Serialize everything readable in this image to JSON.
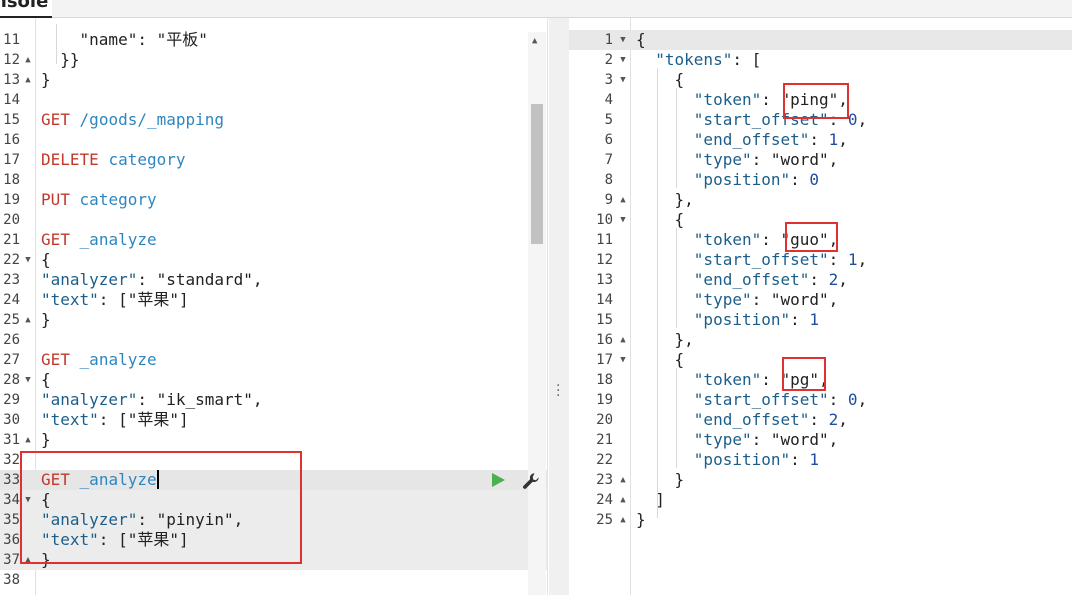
{
  "topbar": {
    "tab_label": "nsole"
  },
  "left_editor": {
    "lines": [
      {
        "n": "11",
        "fold": "",
        "tokens": [
          [
            "p",
            "    \"name\": \"平板\""
          ]
        ]
      },
      {
        "n": "12",
        "fold": "▲",
        "tokens": [
          [
            "p",
            "  }}"
          ]
        ]
      },
      {
        "n": "13",
        "fold": "▲",
        "tokens": [
          [
            "p",
            "}"
          ]
        ]
      },
      {
        "n": "14",
        "fold": "",
        "tokens": []
      },
      {
        "n": "15",
        "fold": "",
        "tokens": [
          [
            "m",
            "GET"
          ],
          [
            "p",
            " "
          ],
          [
            "u",
            "/goods/_mapping"
          ]
        ]
      },
      {
        "n": "16",
        "fold": "",
        "tokens": []
      },
      {
        "n": "17",
        "fold": "",
        "tokens": [
          [
            "m",
            "DELETE"
          ],
          [
            "p",
            " "
          ],
          [
            "u",
            "category"
          ]
        ]
      },
      {
        "n": "18",
        "fold": "",
        "tokens": []
      },
      {
        "n": "19",
        "fold": "",
        "tokens": [
          [
            "m",
            "PUT"
          ],
          [
            "p",
            " "
          ],
          [
            "u",
            "category"
          ]
        ]
      },
      {
        "n": "20",
        "fold": "",
        "tokens": []
      },
      {
        "n": "21",
        "fold": "",
        "tokens": [
          [
            "m",
            "GET"
          ],
          [
            "p",
            " "
          ],
          [
            "u",
            "_analyze"
          ]
        ]
      },
      {
        "n": "22",
        "fold": "▼",
        "tokens": [
          [
            "p",
            "{"
          ]
        ]
      },
      {
        "n": "23",
        "fold": "",
        "tokens": [
          [
            "k",
            "\"analyzer\""
          ],
          [
            "p",
            ": "
          ],
          [
            "s",
            "\"standard\""
          ],
          [
            "p",
            ","
          ]
        ]
      },
      {
        "n": "24",
        "fold": "",
        "tokens": [
          [
            "k",
            "\"text\""
          ],
          [
            "p",
            ": ["
          ],
          [
            "s",
            "\"苹果\""
          ],
          [
            "p",
            "]"
          ]
        ]
      },
      {
        "n": "25",
        "fold": "▲",
        "tokens": [
          [
            "p",
            "}"
          ]
        ]
      },
      {
        "n": "26",
        "fold": "",
        "tokens": []
      },
      {
        "n": "27",
        "fold": "",
        "tokens": [
          [
            "m",
            "GET"
          ],
          [
            "p",
            " "
          ],
          [
            "u",
            "_analyze"
          ]
        ]
      },
      {
        "n": "28",
        "fold": "▼",
        "tokens": [
          [
            "p",
            "{"
          ]
        ]
      },
      {
        "n": "29",
        "fold": "",
        "tokens": [
          [
            "k",
            "\"analyzer\""
          ],
          [
            "p",
            ": "
          ],
          [
            "s",
            "\"ik_smart\""
          ],
          [
            "p",
            ","
          ]
        ]
      },
      {
        "n": "30",
        "fold": "",
        "tokens": [
          [
            "k",
            "\"text\""
          ],
          [
            "p",
            ": ["
          ],
          [
            "s",
            "\"苹果\""
          ],
          [
            "p",
            "]"
          ]
        ]
      },
      {
        "n": "31",
        "fold": "▲",
        "tokens": [
          [
            "p",
            "}"
          ]
        ]
      },
      {
        "n": "32",
        "fold": "",
        "tokens": []
      },
      {
        "n": "33",
        "fold": "",
        "tokens": [
          [
            "m",
            "GET"
          ],
          [
            "p",
            " "
          ],
          [
            "u",
            "_analyze"
          ]
        ]
      },
      {
        "n": "34",
        "fold": "▼",
        "tokens": [
          [
            "p",
            "{"
          ]
        ]
      },
      {
        "n": "35",
        "fold": "",
        "tokens": [
          [
            "k",
            "\"analyzer\""
          ],
          [
            "p",
            ": "
          ],
          [
            "s",
            "\"pinyin\""
          ],
          [
            "p",
            ","
          ]
        ]
      },
      {
        "n": "36",
        "fold": "",
        "tokens": [
          [
            "k",
            "\"text\""
          ],
          [
            "p",
            ": ["
          ],
          [
            "s",
            "\"苹果\""
          ],
          [
            "p",
            "]"
          ]
        ]
      },
      {
        "n": "37",
        "fold": "▲",
        "tokens": [
          [
            "p",
            "}"
          ]
        ]
      },
      {
        "n": "38",
        "fold": "",
        "tokens": []
      }
    ]
  },
  "right_editor": {
    "lines": [
      {
        "n": "1",
        "fold": "▼",
        "tokens": [
          [
            "p",
            "{"
          ]
        ]
      },
      {
        "n": "2",
        "fold": "▼",
        "tokens": [
          [
            "p",
            "  "
          ],
          [
            "k",
            "\"tokens\""
          ],
          [
            "p",
            ": ["
          ]
        ]
      },
      {
        "n": "3",
        "fold": "▼",
        "tokens": [
          [
            "p",
            "    {"
          ]
        ]
      },
      {
        "n": "4",
        "fold": "",
        "tokens": [
          [
            "p",
            "      "
          ],
          [
            "k",
            "\"token\""
          ],
          [
            "p",
            ": "
          ],
          [
            "s",
            "\"ping\""
          ],
          [
            "p",
            ","
          ]
        ]
      },
      {
        "n": "5",
        "fold": "",
        "tokens": [
          [
            "p",
            "      "
          ],
          [
            "k",
            "\"start_offset\""
          ],
          [
            "p",
            ": "
          ],
          [
            "n",
            "0"
          ],
          [
            "p",
            ","
          ]
        ]
      },
      {
        "n": "6",
        "fold": "",
        "tokens": [
          [
            "p",
            "      "
          ],
          [
            "k",
            "\"end_offset\""
          ],
          [
            "p",
            ": "
          ],
          [
            "n",
            "1"
          ],
          [
            "p",
            ","
          ]
        ]
      },
      {
        "n": "7",
        "fold": "",
        "tokens": [
          [
            "p",
            "      "
          ],
          [
            "k",
            "\"type\""
          ],
          [
            "p",
            ": "
          ],
          [
            "s",
            "\"word\""
          ],
          [
            "p",
            ","
          ]
        ]
      },
      {
        "n": "8",
        "fold": "",
        "tokens": [
          [
            "p",
            "      "
          ],
          [
            "k",
            "\"position\""
          ],
          [
            "p",
            ": "
          ],
          [
            "n",
            "0"
          ]
        ]
      },
      {
        "n": "9",
        "fold": "▲",
        "tokens": [
          [
            "p",
            "    },"
          ]
        ]
      },
      {
        "n": "10",
        "fold": "▼",
        "tokens": [
          [
            "p",
            "    {"
          ]
        ]
      },
      {
        "n": "11",
        "fold": "",
        "tokens": [
          [
            "p",
            "      "
          ],
          [
            "k",
            "\"token\""
          ],
          [
            "p",
            ": "
          ],
          [
            "s",
            "\"guo\""
          ],
          [
            "p",
            ","
          ]
        ]
      },
      {
        "n": "12",
        "fold": "",
        "tokens": [
          [
            "p",
            "      "
          ],
          [
            "k",
            "\"start_offset\""
          ],
          [
            "p",
            ": "
          ],
          [
            "n",
            "1"
          ],
          [
            "p",
            ","
          ]
        ]
      },
      {
        "n": "13",
        "fold": "",
        "tokens": [
          [
            "p",
            "      "
          ],
          [
            "k",
            "\"end_offset\""
          ],
          [
            "p",
            ": "
          ],
          [
            "n",
            "2"
          ],
          [
            "p",
            ","
          ]
        ]
      },
      {
        "n": "14",
        "fold": "",
        "tokens": [
          [
            "p",
            "      "
          ],
          [
            "k",
            "\"type\""
          ],
          [
            "p",
            ": "
          ],
          [
            "s",
            "\"word\""
          ],
          [
            "p",
            ","
          ]
        ]
      },
      {
        "n": "15",
        "fold": "",
        "tokens": [
          [
            "p",
            "      "
          ],
          [
            "k",
            "\"position\""
          ],
          [
            "p",
            ": "
          ],
          [
            "n",
            "1"
          ]
        ]
      },
      {
        "n": "16",
        "fold": "▲",
        "tokens": [
          [
            "p",
            "    },"
          ]
        ]
      },
      {
        "n": "17",
        "fold": "▼",
        "tokens": [
          [
            "p",
            "    {"
          ]
        ]
      },
      {
        "n": "18",
        "fold": "",
        "tokens": [
          [
            "p",
            "      "
          ],
          [
            "k",
            "\"token\""
          ],
          [
            "p",
            ": "
          ],
          [
            "s",
            "\"pg\""
          ],
          [
            "p",
            ","
          ]
        ]
      },
      {
        "n": "19",
        "fold": "",
        "tokens": [
          [
            "p",
            "      "
          ],
          [
            "k",
            "\"start_offset\""
          ],
          [
            "p",
            ": "
          ],
          [
            "n",
            "0"
          ],
          [
            "p",
            ","
          ]
        ]
      },
      {
        "n": "20",
        "fold": "",
        "tokens": [
          [
            "p",
            "      "
          ],
          [
            "k",
            "\"end_offset\""
          ],
          [
            "p",
            ": "
          ],
          [
            "n",
            "2"
          ],
          [
            "p",
            ","
          ]
        ]
      },
      {
        "n": "21",
        "fold": "",
        "tokens": [
          [
            "p",
            "      "
          ],
          [
            "k",
            "\"type\""
          ],
          [
            "p",
            ": "
          ],
          [
            "s",
            "\"word\""
          ],
          [
            "p",
            ","
          ]
        ]
      },
      {
        "n": "22",
        "fold": "",
        "tokens": [
          [
            "p",
            "      "
          ],
          [
            "k",
            "\"position\""
          ],
          [
            "p",
            ": "
          ],
          [
            "n",
            "1"
          ]
        ]
      },
      {
        "n": "23",
        "fold": "▲",
        "tokens": [
          [
            "p",
            "    }"
          ]
        ]
      },
      {
        "n": "24",
        "fold": "▲",
        "tokens": [
          [
            "p",
            "  ]"
          ]
        ]
      },
      {
        "n": "25",
        "fold": "▲",
        "tokens": [
          [
            "p",
            "}"
          ]
        ]
      }
    ]
  },
  "icons": {
    "run": "play-icon",
    "settings": "wrench-icon",
    "split_handle": "vertical-ellipsis-icon"
  },
  "colors": {
    "method": "#c0392b",
    "url": "#2e86c1",
    "key": "#1b5e8a",
    "number": "#1f4ea0",
    "highlight_box": "#e03131",
    "run_button": "#4caf50"
  }
}
